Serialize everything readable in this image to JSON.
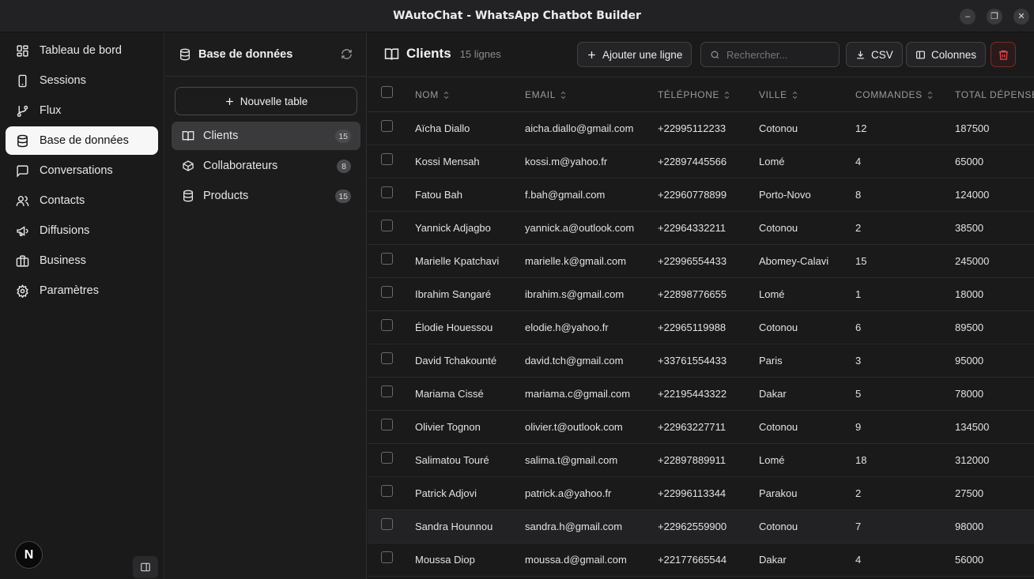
{
  "window": {
    "title": "WAutoChat - WhatsApp Chatbot Builder"
  },
  "nav": {
    "items": [
      {
        "label": "Tableau de bord",
        "icon": "dashboard-icon"
      },
      {
        "label": "Sessions",
        "icon": "phone-icon"
      },
      {
        "label": "Flux",
        "icon": "git-branch-icon"
      },
      {
        "label": "Base de données",
        "icon": "database-icon",
        "active": true
      },
      {
        "label": "Conversations",
        "icon": "message-icon"
      },
      {
        "label": "Contacts",
        "icon": "users-icon"
      },
      {
        "label": "Diffusions",
        "icon": "megaphone-icon"
      },
      {
        "label": "Business",
        "icon": "briefcase-icon"
      },
      {
        "label": "Paramètres",
        "icon": "gear-icon"
      }
    ],
    "avatar_letter": "N"
  },
  "tables_panel": {
    "title": "Base de données",
    "new_table_label": "Nouvelle table",
    "items": [
      {
        "label": "Clients",
        "count": "15",
        "icon": "book-icon",
        "active": true
      },
      {
        "label": "Collaborateurs",
        "count": "8",
        "icon": "box-icon"
      },
      {
        "label": "Products",
        "count": "15",
        "icon": "database-icon"
      }
    ]
  },
  "main": {
    "title": "Clients",
    "subtitle": "15 lignes",
    "add_row_label": "Ajouter une ligne",
    "search_placeholder": "Rechercher...",
    "csv_label": "CSV",
    "columns_label": "Colonnes",
    "accent_danger": "#e5484d",
    "columns": [
      "NOM",
      "EMAIL",
      "TÉLÉPHONE",
      "VILLE",
      "COMMANDES",
      "TOTAL DÉPENSÉ"
    ],
    "rows": [
      [
        "Aïcha Diallo",
        "aicha.diallo@gmail.com",
        "+22995112233",
        "Cotonou",
        "12",
        "187500"
      ],
      [
        "Kossi Mensah",
        "kossi.m@yahoo.fr",
        "+22897445566",
        "Lomé",
        "4",
        "65000"
      ],
      [
        "Fatou Bah",
        "f.bah@gmail.com",
        "+22960778899",
        "Porto-Novo",
        "8",
        "124000"
      ],
      [
        "Yannick Adjagbo",
        "yannick.a@outlook.com",
        "+22964332211",
        "Cotonou",
        "2",
        "38500"
      ],
      [
        "Marielle Kpatchavi",
        "marielle.k@gmail.com",
        "+22996554433",
        "Abomey-Calavi",
        "15",
        "245000"
      ],
      [
        "Ibrahim Sangaré",
        "ibrahim.s@gmail.com",
        "+22898776655",
        "Lomé",
        "1",
        "18000"
      ],
      [
        "Élodie Houessou",
        "elodie.h@yahoo.fr",
        "+22965119988",
        "Cotonou",
        "6",
        "89500"
      ],
      [
        "David Tchakounté",
        "david.tch@gmail.com",
        "+33761554433",
        "Paris",
        "3",
        "95000"
      ],
      [
        "Mariama Cissé",
        "mariama.c@gmail.com",
        "+22195443322",
        "Dakar",
        "5",
        "78000"
      ],
      [
        "Olivier Tognon",
        "olivier.t@outlook.com",
        "+22963227711",
        "Cotonou",
        "9",
        "134500"
      ],
      [
        "Salimatou Touré",
        "salima.t@gmail.com",
        "+22897889911",
        "Lomé",
        "18",
        "312000"
      ],
      [
        "Patrick Adjovi",
        "patrick.a@yahoo.fr",
        "+22996113344",
        "Parakou",
        "2",
        "27500"
      ],
      [
        "Sandra Hounnou",
        "sandra.h@gmail.com",
        "+22962559900",
        "Cotonou",
        "7",
        "98000"
      ],
      [
        "Moussa Diop",
        "moussa.d@gmail.com",
        "+22177665544",
        "Dakar",
        "4",
        "56000"
      ]
    ]
  }
}
